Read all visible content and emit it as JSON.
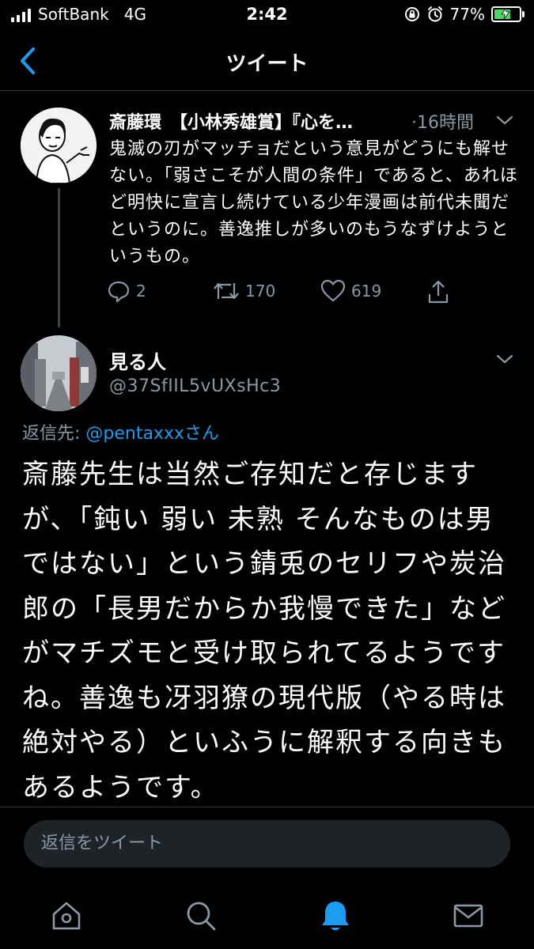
{
  "status_bar": {
    "carrier": "SoftBank",
    "network": "4G",
    "time": "2:42",
    "battery_percent": "77%",
    "battery_level": 0.77
  },
  "header": {
    "title": "ツイート"
  },
  "tweet1": {
    "display_name": "斎藤環　【小林秀雄賞】『心を…",
    "time": "·16時間",
    "body": "鬼滅の刃がマッチョだという意見がどうにも解せない。「弱さこそが人間の条件」であると、あれほど明快に宣言し続けている少年漫画は前代未聞だというのに。善逸推しが多いのもうなずけようというもの。",
    "reply_count": "2",
    "retweet_count": "170",
    "like_count": "619"
  },
  "tweet2": {
    "display_name": "見る人",
    "handle": "@37SfIIL5vUXsHc3",
    "reply_to_prefix": "返信先: ",
    "reply_to_mention": "@pentaxxxさん",
    "body": "斎藤先生は当然ご存知だと存じますが、「鈍い 弱い 未熟 そんなものは男ではない」という錆兎のセリフや炭治郎の「長男だからか我慢できた」などがマチズモと受け取られてるようですね。善逸も冴羽獠の現代版（やる時は絶対やる）といふうに解釈する向きもあるようです。"
  },
  "reply_bar": {
    "placeholder": "返信をツイート"
  },
  "tab_bar": {
    "active": "notifications"
  },
  "colors": {
    "background": "#000000",
    "accent": "#1d9bf0",
    "secondary_text": "#8b98a5",
    "divider": "#2f3336"
  }
}
